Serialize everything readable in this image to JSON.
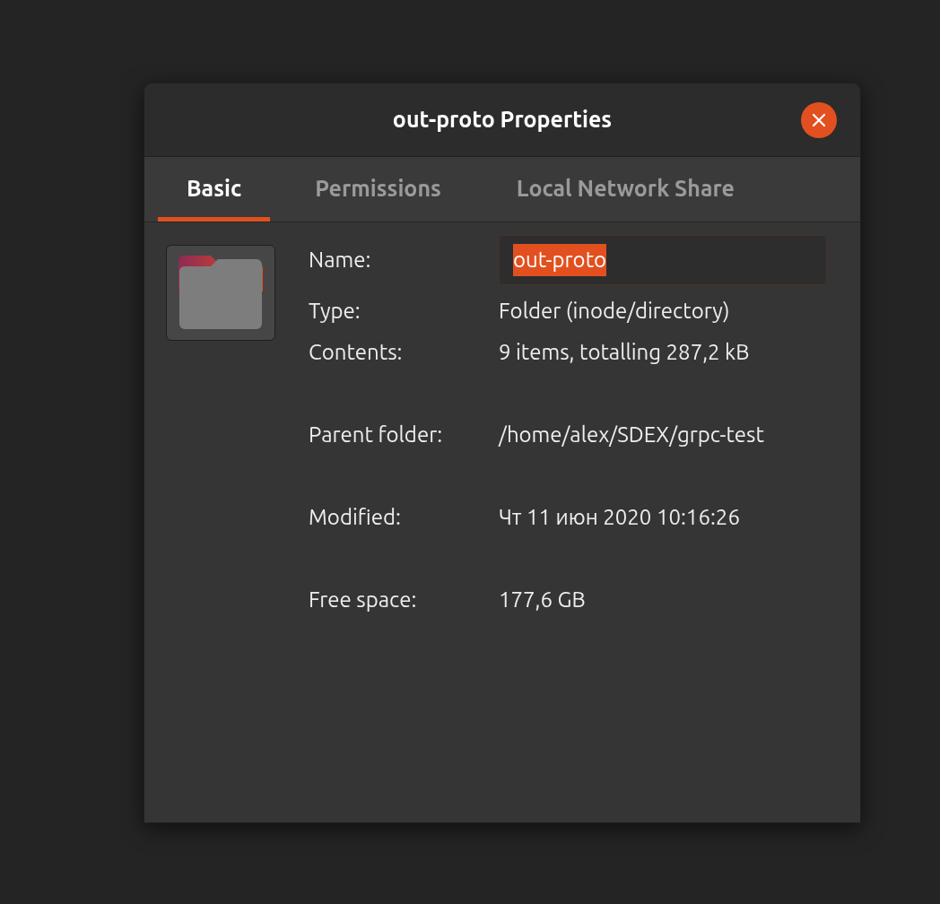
{
  "window": {
    "title": "out-proto Properties"
  },
  "tabs": [
    {
      "label": "Basic",
      "selected": true
    },
    {
      "label": "Permissions",
      "selected": false
    },
    {
      "label": "Local Network Share",
      "selected": false
    }
  ],
  "name_field": {
    "label": "Name:",
    "value": "out-proto",
    "text_selected": true
  },
  "groups": [
    [
      {
        "label": "Type:",
        "value": "Folder (inode/directory)"
      },
      {
        "label": "Contents:",
        "value": "9 items, totalling 287,2 kB"
      }
    ],
    [
      {
        "label": "Parent folder:",
        "value": "/home/alex/SDEX/grpc-test"
      }
    ],
    [
      {
        "label": "Modified:",
        "value": "Чт 11 июн 2020 10:16:26"
      }
    ],
    [
      {
        "label": "Free space:",
        "value": "177,6 GB"
      }
    ]
  ]
}
